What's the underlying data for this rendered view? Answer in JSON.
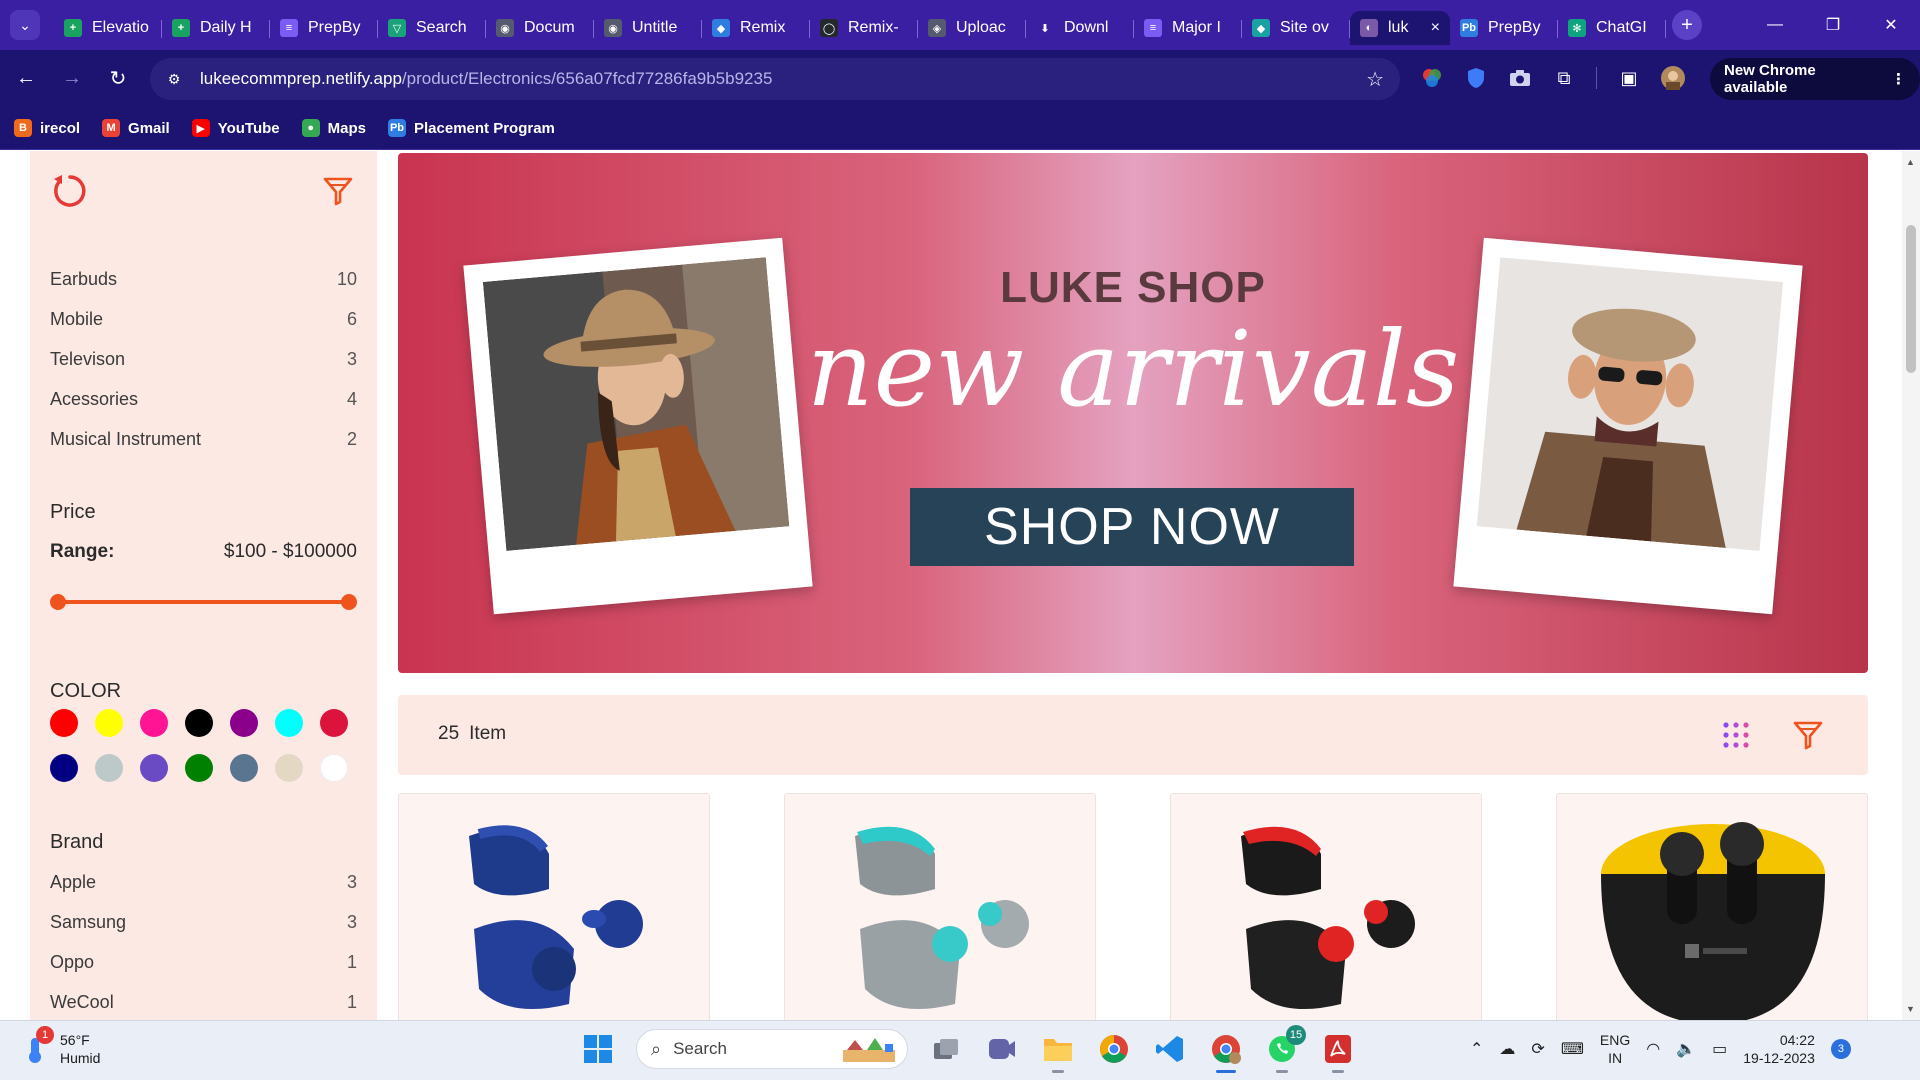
{
  "browser": {
    "tabs": [
      {
        "label": "Elevatio",
        "color": "#1aa260",
        "glyph": "+"
      },
      {
        "label": "Daily H",
        "color": "#1aa260",
        "glyph": "+"
      },
      {
        "label": "PrepBy",
        "color": "#7b5cf5",
        "glyph": "≡"
      },
      {
        "label": "Search",
        "color": "#1aa27a",
        "glyph": "▽"
      },
      {
        "label": "Docum",
        "color": "#555a6e",
        "glyph": "◉"
      },
      {
        "label": "Untitle",
        "color": "#555a6e",
        "glyph": "◉"
      },
      {
        "label": "Remix",
        "color": "#2f7de1",
        "glyph": "◆"
      },
      {
        "label": "Remix-",
        "color": "#24292e",
        "glyph": "◯"
      },
      {
        "label": "Uploac",
        "color": "#555a6e",
        "glyph": "◈"
      },
      {
        "label": "Downl",
        "color": "#3b1fa3",
        "glyph": "⬇"
      },
      {
        "label": "Major I",
        "color": "#7b5cf5",
        "glyph": "≡"
      },
      {
        "label": "Site ov",
        "color": "#1aa2a2",
        "glyph": "◆"
      }
    ],
    "active_tab": {
      "label": "luk",
      "close": "×"
    },
    "tabs_after": [
      {
        "label": "PrepBy",
        "color": "#2f7de1",
        "glyph": "Pb"
      },
      {
        "label": "ChatGI",
        "color": "#10a37f",
        "glyph": "✻"
      }
    ],
    "new_tab": "+",
    "url_host": "lukeecommprep.netlify.app",
    "url_path": "/product/Electronics/656a07fcd77286fa9b5b9235",
    "new_chrome_label": "New Chrome available",
    "bookmarks": [
      {
        "label": "irecol",
        "color": "#f06a1e",
        "glyph": "B"
      },
      {
        "label": "Gmail",
        "color": "#ea4335",
        "glyph": "M"
      },
      {
        "label": "YouTube",
        "color": "#ff0000",
        "glyph": "▶"
      },
      {
        "label": "Maps",
        "color": "#34a853",
        "glyph": "●"
      },
      {
        "label": "Placement Program",
        "color": "#2f7de1",
        "glyph": "Pb"
      }
    ]
  },
  "sidebar": {
    "categories": [
      {
        "name": "Earbuds",
        "count": "10"
      },
      {
        "name": "Mobile",
        "count": "6"
      },
      {
        "name": "Televison",
        "count": "3"
      },
      {
        "name": "Acessories",
        "count": "4"
      },
      {
        "name": "Musical Instrument",
        "count": "2"
      }
    ],
    "price_heading": "Price",
    "range_label": "Range:",
    "range_value": "$100 - $100000",
    "slider": {
      "min_fraction": 0.0,
      "max_fraction": 1.0
    },
    "color_heading": "COLOR",
    "colors": [
      "#ff0000",
      "#ffff00",
      "#ff1493",
      "#000000",
      "#8b008b",
      "#00ffff",
      "#dc143c",
      "#000080",
      "#bdc9c9",
      "#6a4bc4",
      "#008000",
      "#5a7590",
      "#e4d7c4",
      "#ffffff"
    ],
    "brand_heading": "Brand",
    "brands": [
      {
        "name": "Apple",
        "count": "3"
      },
      {
        "name": "Samsung",
        "count": "3"
      },
      {
        "name": "Oppo",
        "count": "1"
      },
      {
        "name": "WeCool",
        "count": "1"
      }
    ]
  },
  "banner": {
    "title": "LUKE SHOP",
    "script": "new arrivals",
    "button": "SHOP NOW"
  },
  "listing": {
    "count": "25",
    "count_label": "Item"
  },
  "taskbar": {
    "temp": "56°F",
    "condition": "Humid",
    "weather_badge": "1",
    "search_placeholder": "Search",
    "whatsapp_badge": "15",
    "lang_line1": "ENG",
    "lang_line2": "IN",
    "time": "04:22",
    "date": "19-12-2023",
    "notifications": "3"
  }
}
